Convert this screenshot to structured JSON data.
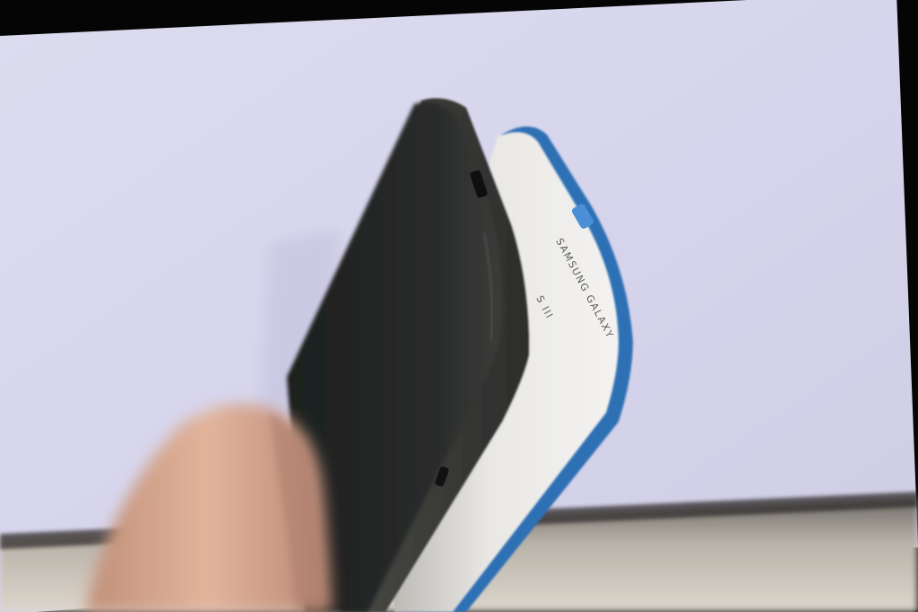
{
  "scene": {
    "subject": "two smartphones held edge-on",
    "back_phone": {
      "body_color": "#e7e6e3",
      "accent_color": "#2e6fb4",
      "side_text_1": "SAMSUNG GALAXY",
      "side_text_2": "S III"
    },
    "front_phone": {
      "body_color": "#2b2b2b"
    },
    "background_color": "#d7d5ec",
    "hand_color": "#d8a98f"
  }
}
